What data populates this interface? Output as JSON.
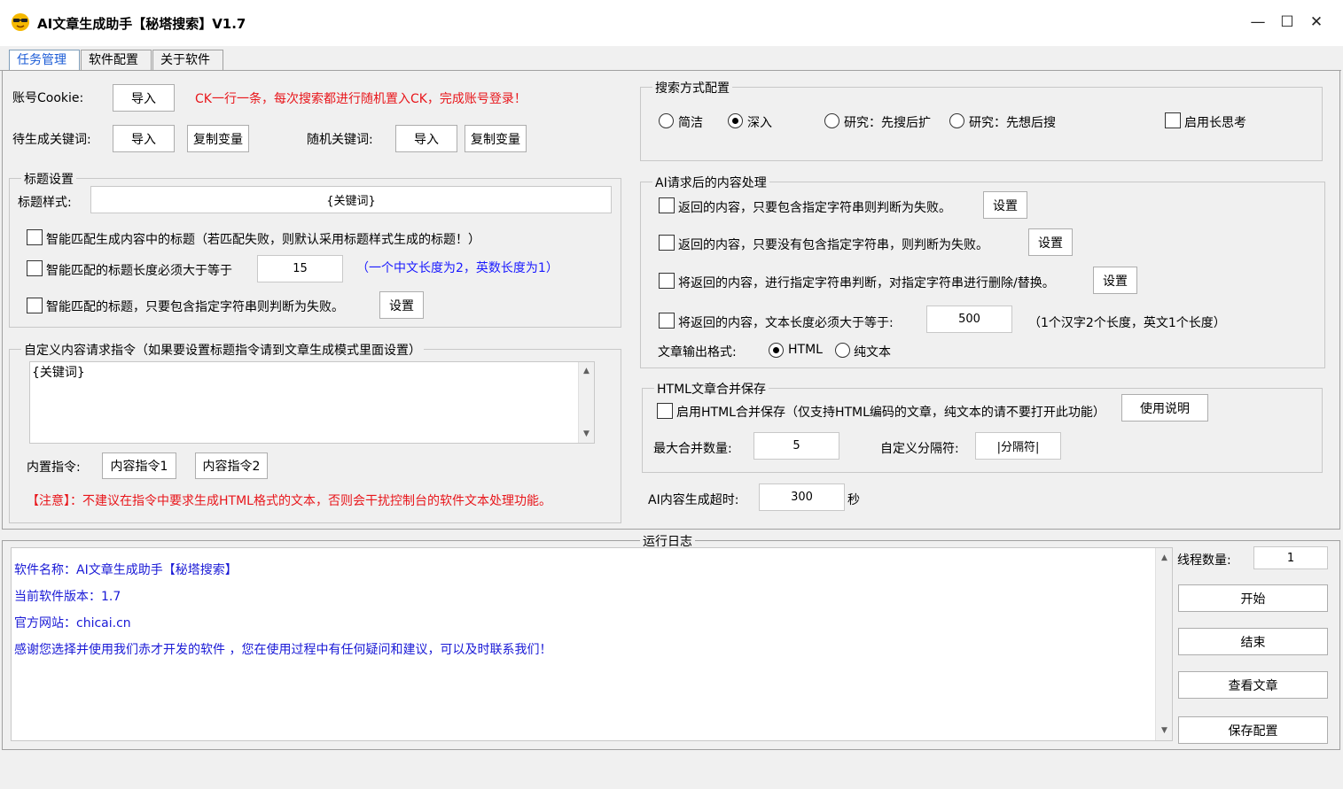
{
  "window": {
    "title": "AI文章生成助手【秘塔搜索】V1.7",
    "controls": {
      "minimize": "—",
      "maximize": "☐",
      "close": "✕"
    }
  },
  "tabs": [
    {
      "label": "任务管理",
      "active": true
    },
    {
      "label": "软件配置",
      "active": false
    },
    {
      "label": "关于软件",
      "active": false
    }
  ],
  "account": {
    "cookie_label": "账号Cookie:",
    "import_label": "导入",
    "tip": "CK一行一条，每次搜索都进行随机置入CK，完成账号登录！"
  },
  "keywords": {
    "pending_label": "待生成关键词:",
    "pending_import": "导入",
    "pending_copy": "复制变量",
    "random_label": "随机关键词:",
    "random_import": "导入",
    "random_copy": "复制变量"
  },
  "title_settings": {
    "group_title": "标题设置",
    "style_label": "标题样式:",
    "style_value": "{关键词}",
    "smart_match_label": "智能匹配生成内容中的标题（若匹配失败，则默认采用标题样式生成的标题！）",
    "min_length_label": "智能匹配的标题长度必须大于等于",
    "min_length_value": "15",
    "min_length_hint": "（一个中文长度为2，英数长度为1）",
    "contains_fail_label": "智能匹配的标题，只要包含指定字符串则判断为失败。",
    "contains_fail_button": "设置"
  },
  "custom_prompt": {
    "group_title": "自定义内容请求指令（如果要设置标题指令请到文章生成模式里面设置）",
    "text": "{关键词}",
    "builtin_label": "内置指令:",
    "builtin_1": "内容指令1",
    "builtin_2": "内容指令2",
    "notice": "【注意】：不建议在指令中要求生成HTML格式的文本，否则会干扰控制台的软件文本处理功能。"
  },
  "search_mode": {
    "group_title": "搜索方式配置",
    "options": [
      {
        "label": "简洁",
        "selected": false
      },
      {
        "label": "深入",
        "selected": true
      },
      {
        "label": "研究：先搜后扩",
        "selected": false
      },
      {
        "label": "研究：先想后搜",
        "selected": false
      }
    ],
    "long_think_label": "启用长思考"
  },
  "post_process": {
    "group_title": "AI请求后的内容处理",
    "rule1": "返回的内容，只要包含指定字符串则判断为失败。",
    "rule1_button": "设置",
    "rule2": "返回的内容，只要没有包含指定字符串，则判断为失败。",
    "rule2_button": "设置",
    "rule3": "将返回的内容，进行指定字符串判断，对指定字符串进行删除/替换。",
    "rule3_button": "设置",
    "rule4": "将返回的内容，文本长度必须大于等于:",
    "rule4_value": "500",
    "rule4_hint": "（1个汉字2个长度，英文1个长度）",
    "format_label": "文章输出格式:",
    "format_html": "HTML",
    "format_text": "纯文本"
  },
  "html_merge": {
    "group_title": "HTML文章合并保存",
    "enable_label": "启用HTML合并保存（仅支持HTML编码的文章，纯文本的请不要打开此功能）",
    "help_button": "使用说明",
    "max_label": "最大合并数量:",
    "max_value": "5",
    "sep_label": "自定义分隔符:",
    "sep_value": "|分隔符|"
  },
  "timeout": {
    "label": "AI内容生成超时:",
    "value": "300",
    "unit": "秒"
  },
  "log": {
    "group_title": "运行日志",
    "lines": [
      "软件名称：AI文章生成助手【秘塔搜索】",
      "当前软件版本：1.7",
      "官方网站：chicai.cn",
      "感谢您选择并使用我们赤才开发的软件 ，您在使用过程中有任何疑问和建议，可以及时联系我们！"
    ]
  },
  "controls": {
    "threads_label": "线程数量:",
    "threads_value": "1",
    "start": "开始",
    "stop": "结束",
    "view": "查看文章",
    "save": "保存配置"
  },
  "colors": {
    "accent_blue": "#1a5bd6",
    "hint_blue": "#1a1aff",
    "warning_red": "#e8161b",
    "log_blue": "#1a1ad6"
  }
}
